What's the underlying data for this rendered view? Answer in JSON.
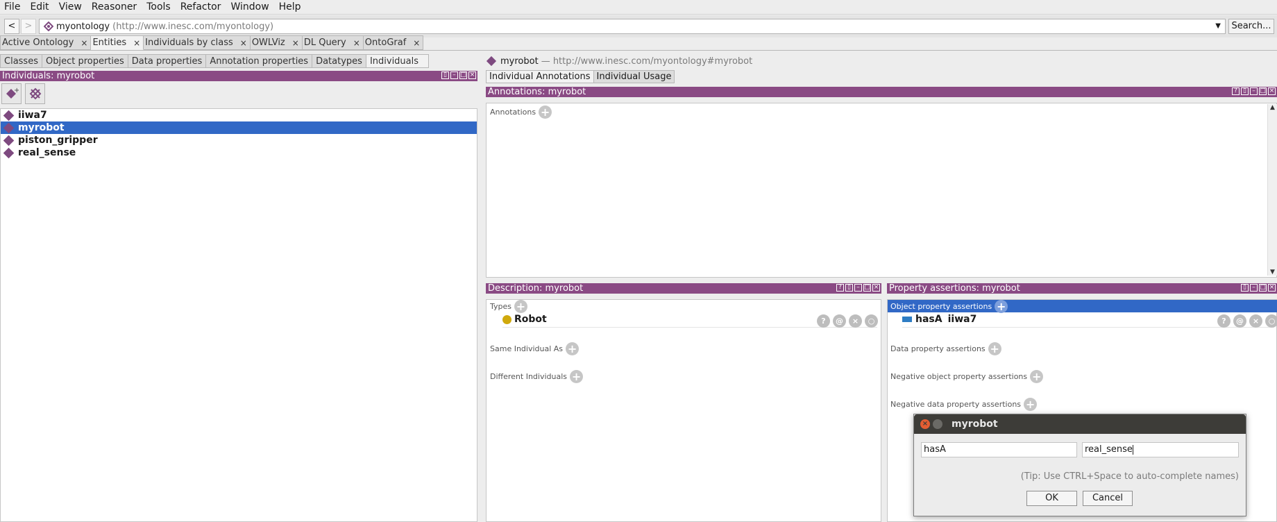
{
  "menubar": [
    "File",
    "Edit",
    "View",
    "Reasoner",
    "Tools",
    "Refactor",
    "Window",
    "Help"
  ],
  "address": {
    "back_label": "<",
    "forward_label": ">",
    "ontology_name": "myontology",
    "ontology_url": "(http://www.inesc.com/myontology)",
    "search_label": "Search..."
  },
  "workspace_tabs": [
    {
      "label": "Active Ontology"
    },
    {
      "label": "Entities"
    },
    {
      "label": "Individuals by class"
    },
    {
      "label": "OWLViz"
    },
    {
      "label": "DL Query"
    },
    {
      "label": "OntoGraf"
    }
  ],
  "tab_close_glyph": "×",
  "entity_tabs": [
    "Classes",
    "Object properties",
    "Data properties",
    "Annotation properties",
    "Datatypes",
    "Individuals"
  ],
  "individuals_panel": {
    "title": "Individuals: myrobot",
    "items": [
      "iiwa7",
      "myrobot",
      "piston_gripper",
      "real_sense"
    ],
    "selected": "myrobot"
  },
  "entity_header": {
    "name": "myrobot",
    "iri": "— http://www.inesc.com/myontology#myrobot"
  },
  "right_tabs": [
    "Individual Annotations",
    "Individual Usage"
  ],
  "annotations_panel": {
    "title": "Annotations: myrobot",
    "section_label": "Annotations"
  },
  "description_panel": {
    "title": "Description: myrobot",
    "types_label": "Types",
    "type_value": "Robot",
    "same_label": "Same Individual As",
    "different_label": "Different Individuals"
  },
  "property_panel": {
    "title": "Property assertions: myrobot",
    "object_label": "Object property assertions",
    "assertion_property": "hasA",
    "assertion_value": "iiwa7",
    "data_label": "Data property assertions",
    "neg_object_label": "Negative object property assertions",
    "neg_data_label": "Negative data property assertions"
  },
  "row_buttons": [
    "?",
    "@",
    "×",
    "○"
  ],
  "dialog": {
    "title": "myrobot",
    "property_value": "hasA",
    "individual_value": "real_sense",
    "tip": "(Tip: Use CTRL+Space to auto-complete names)",
    "ok_label": "OK",
    "cancel_label": "Cancel"
  },
  "colors": {
    "header_purple": "#8a4a84",
    "selection_blue": "#3168c6",
    "individual_diamond": "#7e4a80",
    "class_circle": "#d0a90c",
    "object_property": "#2e7dc4"
  }
}
